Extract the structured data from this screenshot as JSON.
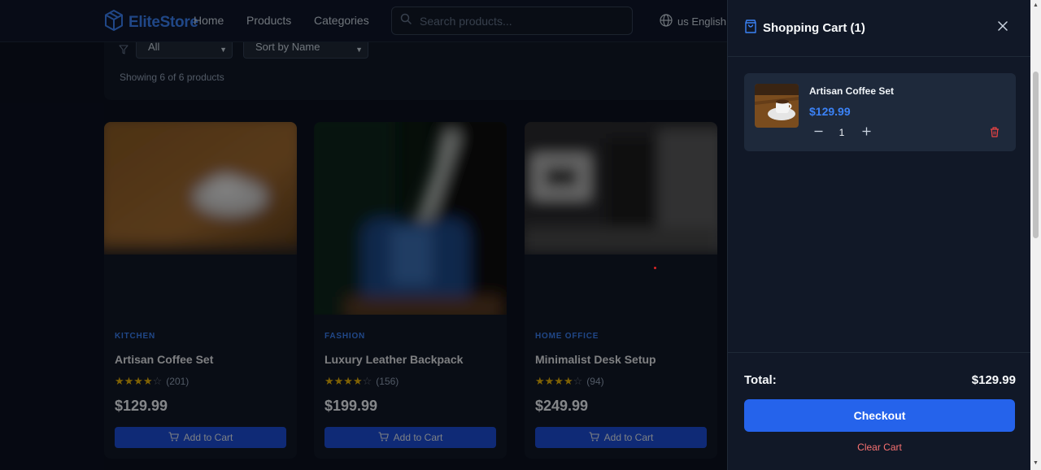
{
  "navbar": {
    "brand": "EliteStore",
    "links": [
      "Home",
      "Products",
      "Categories"
    ],
    "search_placeholder": "Search products...",
    "language": "us English"
  },
  "filters": {
    "category_selected": "All",
    "sort_selected": "Sort by Name",
    "showing_text": "Showing 6 of 6 products"
  },
  "products": [
    {
      "category": "KITCHEN",
      "name": "Artisan Coffee Set",
      "rating": 4,
      "reviews": "(201)",
      "price": "$129.99",
      "button": "Add to Cart"
    },
    {
      "category": "FASHION",
      "name": "Luxury Leather Backpack",
      "rating": 4,
      "reviews": "(156)",
      "price": "$199.99",
      "button": "Add to Cart"
    },
    {
      "category": "HOME OFFICE",
      "name": "Minimalist Desk Setup",
      "rating": 4,
      "reviews": "(94)",
      "price": "$249.99",
      "button": "Add to Cart"
    }
  ],
  "cart": {
    "title": "Shopping Cart (1)",
    "items": [
      {
        "name": "Artisan Coffee Set",
        "price": "$129.99",
        "quantity": "1"
      }
    ],
    "total_label": "Total:",
    "total_value": "$129.99",
    "checkout_label": "Checkout",
    "clear_label": "Clear Cart"
  },
  "colors": {
    "accent": "#2563eb",
    "brand": "#3b82f6",
    "danger": "#f87171",
    "star": "#eab308"
  },
  "icons": {
    "brand": "box-icon",
    "search": "search-icon",
    "language": "globe-icon",
    "filter": "filter-icon",
    "cart": "shopping-bag-icon",
    "close": "close-icon",
    "add_to_cart": "cart-icon",
    "remove": "trash-icon"
  }
}
